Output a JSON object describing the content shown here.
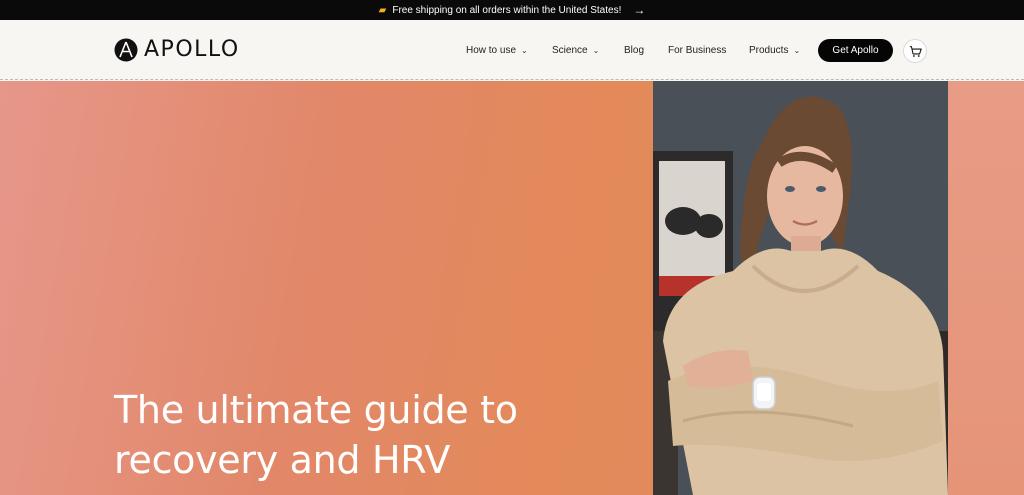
{
  "announcement": {
    "icon": "truck-icon",
    "text": "Free shipping on all orders within the United States!",
    "arrow_icon": "arrow-right-icon"
  },
  "brand": {
    "name": "APOLLO",
    "logo_icon": "apollo-logo-icon"
  },
  "nav": {
    "items": [
      {
        "label": "How to use",
        "has_dropdown": true
      },
      {
        "label": "Science",
        "has_dropdown": true
      },
      {
        "label": "Blog",
        "has_dropdown": false
      },
      {
        "label": "For Business",
        "has_dropdown": false
      },
      {
        "label": "Products",
        "has_dropdown": true
      }
    ],
    "cta_label": "Get Apollo",
    "cart_icon": "cart-icon"
  },
  "hero": {
    "title": "The ultimate guide to recovery and HRV",
    "image_alt": "Woman in beige hoodie wearing Apollo wearable on wrist"
  },
  "colors": {
    "accent_dark": "#050505",
    "hero_gradient_start": "#e6978a",
    "hero_gradient_end": "#e3895a"
  }
}
